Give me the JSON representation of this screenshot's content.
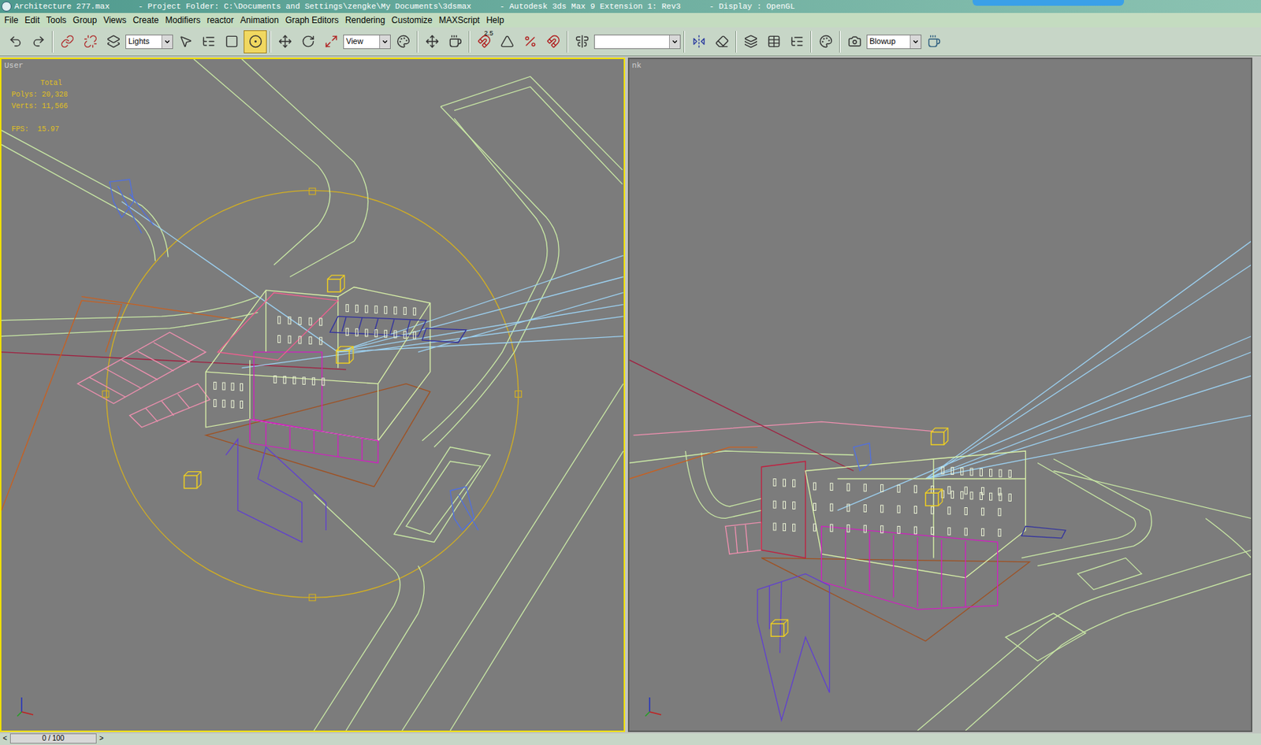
{
  "window": {
    "title": "Architecture 277.max      - Project Folder: C:\\Documents and Settings\\zengke\\My Documents\\3dsmax      - Autodesk 3ds Max 9 Extension 1: Rev3      - Display : OpenGL"
  },
  "menu": [
    "File",
    "Edit",
    "Tools",
    "Group",
    "Views",
    "Create",
    "Modifiers",
    "reactor",
    "Animation",
    "Graph Editors",
    "Rendering",
    "Customize",
    "MAXScript",
    "Help"
  ],
  "toolbar": {
    "selection_filter": "Lights",
    "reference_coord": "View",
    "named_selection": "",
    "render_preset": "Blowup",
    "snap_label": "2.5"
  },
  "viewports": [
    {
      "label": "User",
      "active": true,
      "stats": {
        "heading": "Total",
        "lines": [
          "Polys: 20,328",
          "Verts: 11,566",
          "",
          "FPS:  15.97"
        ]
      }
    },
    {
      "label": "nk",
      "active": false,
      "stats": null
    }
  ],
  "timeline": {
    "frame": "0 / 100",
    "prev": "<",
    "next": ">"
  }
}
